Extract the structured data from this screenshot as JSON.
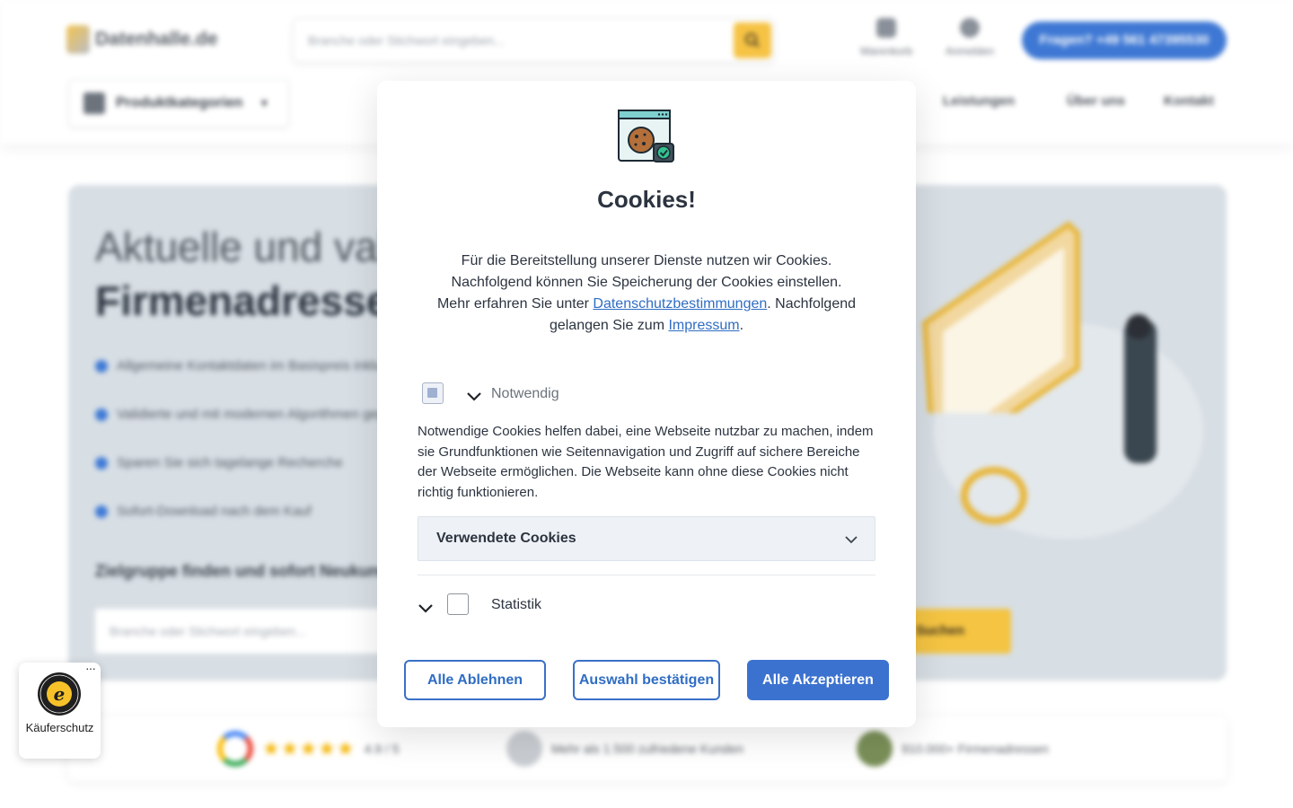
{
  "header": {
    "logo_text": "Datenhalle.de",
    "search_placeholder": "Branche oder Stichwort eingeben...",
    "cart_label": "Warenkorb",
    "login_label": "Anmelden",
    "cta_label": "Fragen? +49 561 47395530",
    "category_button": "Produktkategorien",
    "nav": [
      "Leistungen",
      "Über uns",
      "Kontakt"
    ]
  },
  "hero": {
    "line1": "Aktuelle und validierte",
    "line2": "Firmenadressen",
    "bullets": [
      "Allgemeine Kontaktdaten im Basispreis inklusive",
      "Validierte und mit modernen Algorithmen geprüfte Daten",
      "Sparen Sie sich tagelange Recherche",
      "Sofort-Download nach dem Kauf"
    ],
    "subheading": "Zielgruppe finden und sofort Neukunden gewinnen",
    "input_placeholder": "Branche oder Stichwort eingeben...",
    "search_button": "Suchen"
  },
  "trust_strip": {
    "rating": "4.9 / 5",
    "customers": "Mehr als 1.500 zufriedene Kunden",
    "addresses": "910.000+ Firmenadressen"
  },
  "cookie_dialog": {
    "title": "Cookies!",
    "intro_line1": "Für die Bereitstellung unserer Dienste nutzen wir Cookies. Nachfolgend können Sie Speicherung der Cookies einstellen.",
    "intro_pre_link1": "Mehr erfahren Sie unter ",
    "link1": "Datenschutzbestimmungen",
    "intro_mid": ". Nachfolgend gelangen Sie zum ",
    "link2": "Impressum",
    "intro_end": ".",
    "categories": [
      {
        "label": "Notwendig",
        "checked": true,
        "disabled": true,
        "expanded": true
      },
      {
        "label": "Statistik",
        "checked": false,
        "disabled": false,
        "expanded": false
      }
    ],
    "necessary_description": "Notwendige Cookies helfen dabei, eine Webseite nutzbar zu machen, indem sie Grundfunktionen wie Seitennavigation und Zugriff auf sichere Bereiche der Webseite ermöglichen. Die Webseite kann ohne diese Cookies nicht richtig funktionieren.",
    "used_cookies_label": "Verwendete Cookies",
    "buttons": {
      "reject": "Alle Ablehnen",
      "confirm": "Auswahl bestätigen",
      "accept": "Alle Akzeptieren"
    }
  },
  "trusted_shops": {
    "label": "Käuferschutz",
    "menu": "···"
  },
  "colors": {
    "accent_blue": "#3b72cf",
    "link_blue": "#2f6dc4",
    "brand_yellow": "#f6c344",
    "text_dark": "#2c3440"
  }
}
